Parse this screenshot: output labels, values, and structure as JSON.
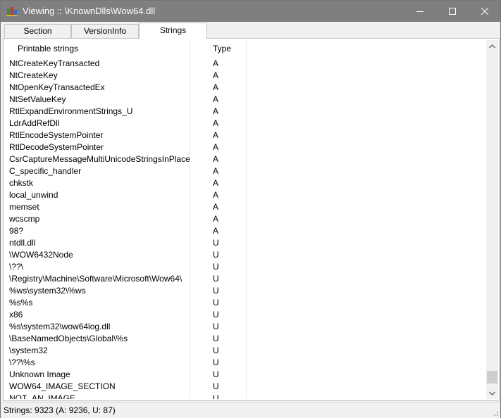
{
  "window": {
    "title": "Viewing :: \\KnownDlls\\Wow64.dll"
  },
  "tabs": [
    {
      "label": "Section",
      "active": false
    },
    {
      "label": "VersionInfo",
      "active": false
    },
    {
      "label": "Strings",
      "active": true
    }
  ],
  "list": {
    "columns": [
      "Printable strings",
      "Type"
    ],
    "rows": [
      {
        "name": "NtCreateKeyTransacted",
        "type": "A"
      },
      {
        "name": "NtCreateKey",
        "type": "A"
      },
      {
        "name": "NtOpenKeyTransactedEx",
        "type": "A"
      },
      {
        "name": "NtSetValueKey",
        "type": "A"
      },
      {
        "name": "RtlExpandEnvironmentStrings_U",
        "type": "A"
      },
      {
        "name": "LdrAddRefDll",
        "type": "A"
      },
      {
        "name": "RtlEncodeSystemPointer",
        "type": "A"
      },
      {
        "name": "RtlDecodeSystemPointer",
        "type": "A"
      },
      {
        "name": "CsrCaptureMessageMultiUnicodeStringsInPlace",
        "type": "A"
      },
      {
        "name": "C_specific_handler",
        "type": "A"
      },
      {
        "name": "chkstk",
        "type": "A"
      },
      {
        "name": "local_unwind",
        "type": "A"
      },
      {
        "name": "memset",
        "type": "A"
      },
      {
        "name": "wcscmp",
        "type": "A"
      },
      {
        "name": "98?",
        "type": "A"
      },
      {
        "name": "ntdll.dll",
        "type": "U"
      },
      {
        "name": "\\WOW6432Node",
        "type": "U"
      },
      {
        "name": "\\??\\",
        "type": "U"
      },
      {
        "name": "\\Registry\\Machine\\Software\\Microsoft\\Wow64\\",
        "type": "U"
      },
      {
        "name": "%ws\\system32\\%ws",
        "type": "U"
      },
      {
        "name": "%s%s",
        "type": "U"
      },
      {
        "name": "x86",
        "type": "U"
      },
      {
        "name": "%s\\system32\\wow64log.dll",
        "type": "U"
      },
      {
        "name": "\\BaseNamedObjects\\Global\\%s",
        "type": "U"
      },
      {
        "name": "\\system32",
        "type": "U"
      },
      {
        "name": "\\??\\%s",
        "type": "U"
      },
      {
        "name": "Unknown Image",
        "type": "U"
      },
      {
        "name": "WOW64_IMAGE_SECTION",
        "type": "U"
      },
      {
        "name": "NOT_AN_IMAGE",
        "type": "U"
      }
    ]
  },
  "status": {
    "text": "Strings: 9323 (A: 9236, U: 87)"
  },
  "colors": {
    "titlebar": "#7f7f7f",
    "panel": "#ffffff",
    "chrome": "#f0f0f0"
  }
}
